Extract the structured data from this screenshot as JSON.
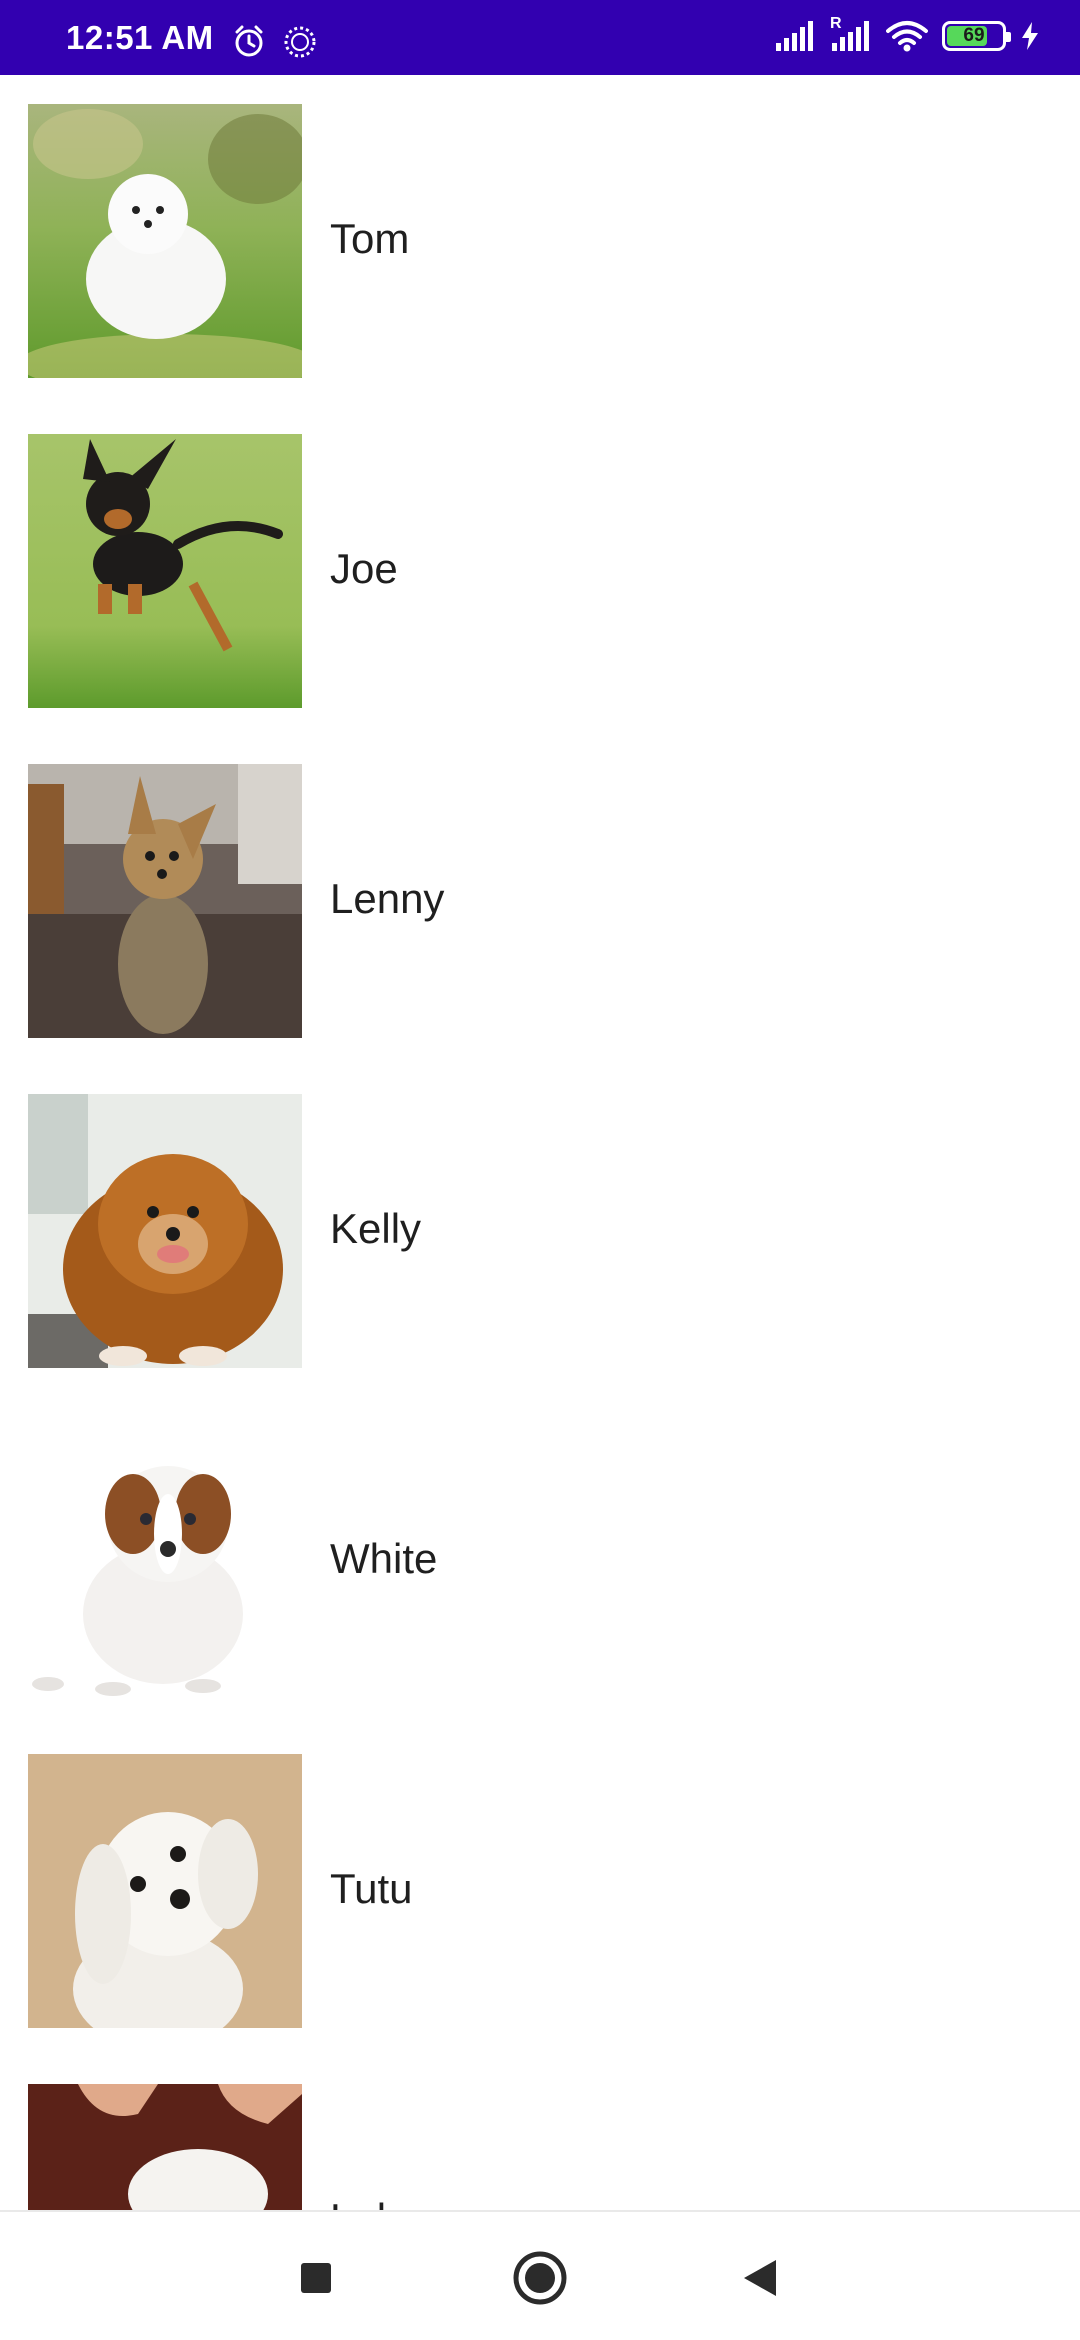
{
  "status_bar": {
    "time": "12:51 AM",
    "battery_level": "69",
    "battery_fraction": 0.69,
    "roaming_label": "R",
    "icons": [
      "alarm-icon",
      "sync-icon",
      "signal-icon",
      "signal-roaming-icon",
      "wifi-icon",
      "battery-icon",
      "charging-icon"
    ],
    "background_color": "#3200b0"
  },
  "dogs": [
    {
      "name": "Tom",
      "photo": "white-pomeranian-on-grass"
    },
    {
      "name": "Joe",
      "photo": "chihuahua-jumping-on-grass"
    },
    {
      "name": "Lenny",
      "photo": "yorkshire-terrier-indoors"
    },
    {
      "name": "Kelly",
      "photo": "orange-pomeranian"
    },
    {
      "name": "White",
      "photo": "jack-russell-puppy"
    },
    {
      "name": "Tutu",
      "photo": "maltese-on-tan-background"
    },
    {
      "name": "Lulu",
      "photo": "white-puppy-held-in-hand"
    }
  ],
  "nav_bar": {
    "buttons": [
      "recents-button",
      "home-button",
      "back-button"
    ]
  }
}
